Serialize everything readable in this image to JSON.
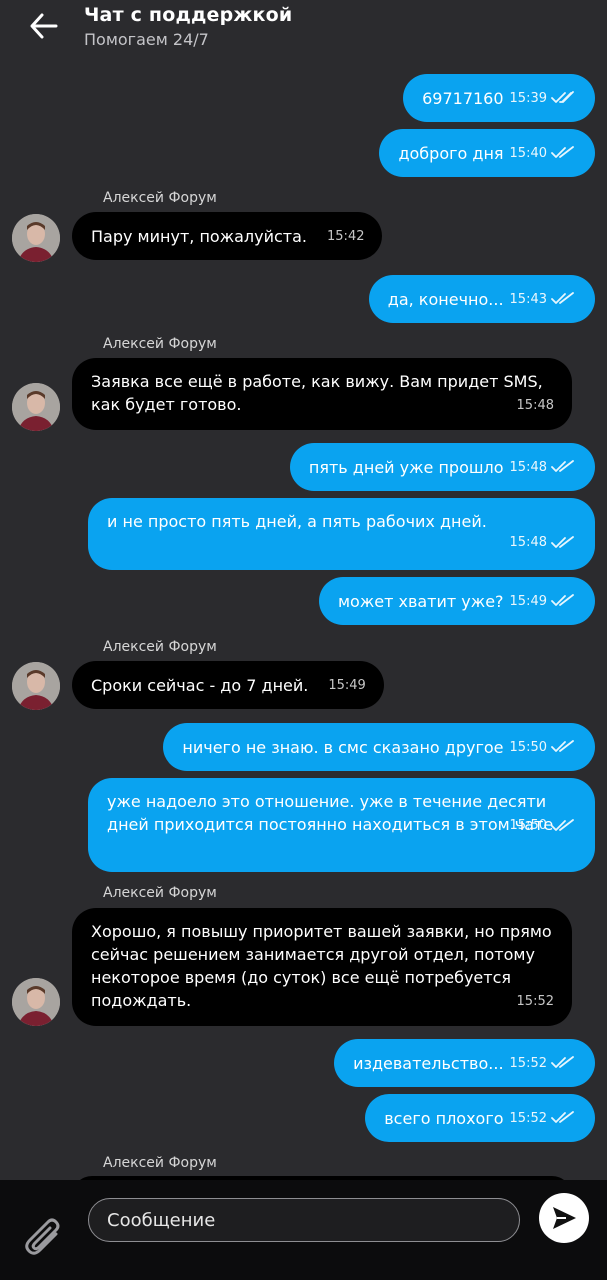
{
  "header": {
    "title": "Чат с поддержкой",
    "subtitle": "Помогаем 24/7"
  },
  "colors": {
    "outgoing_bubble": "#0aa3f0",
    "incoming_bubble": "#000000",
    "background": "#2b2b2e",
    "input_bar": "#0c0c0d"
  },
  "messages": [
    {
      "dir": "out",
      "text": "69717160",
      "time": "15:39"
    },
    {
      "dir": "out",
      "text": "доброго дня",
      "time": "15:40"
    },
    {
      "dir": "in",
      "sender": "Алексей Форум",
      "text": "Пару минут, пожалуйста.",
      "time": "15:42"
    },
    {
      "dir": "out",
      "text": "да, конечно...",
      "time": "15:43"
    },
    {
      "dir": "in",
      "sender": "Алексей Форум",
      "text": "Заявка все ещё в работе, как вижу. Вам придет SMS, как будет готово.",
      "time": "15:48"
    },
    {
      "dir": "out",
      "text": "пять дней уже прошло",
      "time": "15:48"
    },
    {
      "dir": "out",
      "text": "и не просто пять дней, а пять рабочих дней.",
      "time": "15:48"
    },
    {
      "dir": "out",
      "text": "может хватит уже?",
      "time": "15:49"
    },
    {
      "dir": "in",
      "sender": "Алексей Форум",
      "text": "Сроки сейчас - до 7 дней.",
      "time": "15:49"
    },
    {
      "dir": "out",
      "text": "ничего не знаю. в смс сказано другое",
      "time": "15:50"
    },
    {
      "dir": "out",
      "text": "уже надоело это отношение. уже в течение десяти дней приходится постоянно находиться в этом чате",
      "time": "15:50"
    },
    {
      "dir": "in",
      "sender": "Алексей Форум",
      "text": "Хорошо, я повышу приоритет вашей заявки, но прямо сейчас решением занимается другой отдел, потому некоторое время (до суток) все ещё потребуется подождать.",
      "time": "15:52"
    },
    {
      "dir": "out",
      "text": "издевательство...",
      "time": "15:52"
    },
    {
      "dir": "out",
      "text": "всего плохого",
      "time": "15:52"
    },
    {
      "dir": "in",
      "sender": "Алексей Форум",
      "text": "",
      "time": ""
    }
  ],
  "composer": {
    "placeholder": "Сообщение"
  },
  "icons": {
    "back": "arrow-left-icon",
    "attach": "paperclip-icon",
    "send": "send-icon",
    "read": "double-check-icon"
  }
}
